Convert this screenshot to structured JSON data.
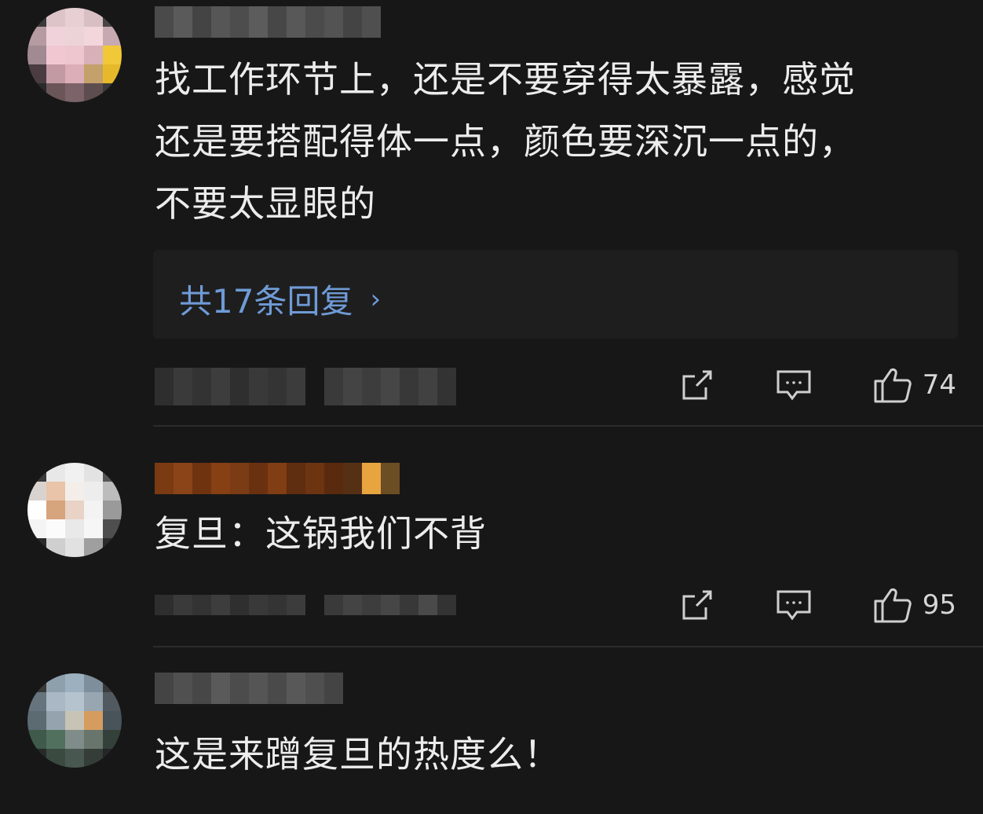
{
  "comments": [
    {
      "text_lines": [
        "找工作环节上，还是不要穿得太暴露，感觉",
        "还是要搭配得体一点，颜色要深沉一点的，",
        "不要太显眼的"
      ],
      "replies_label": "共17条回复",
      "likes": "74"
    },
    {
      "text_lines": [
        "复旦：这锅我们不背"
      ],
      "likes": "95"
    },
    {
      "text_lines": [
        "这是来蹭复旦的热度么！"
      ]
    }
  ],
  "colors": {
    "background": "#171717",
    "reply_link": "#6f9bd6",
    "text": "#ececec"
  },
  "icons": [
    "share-icon",
    "comment-icon",
    "like-icon",
    "chevron-right-icon"
  ]
}
